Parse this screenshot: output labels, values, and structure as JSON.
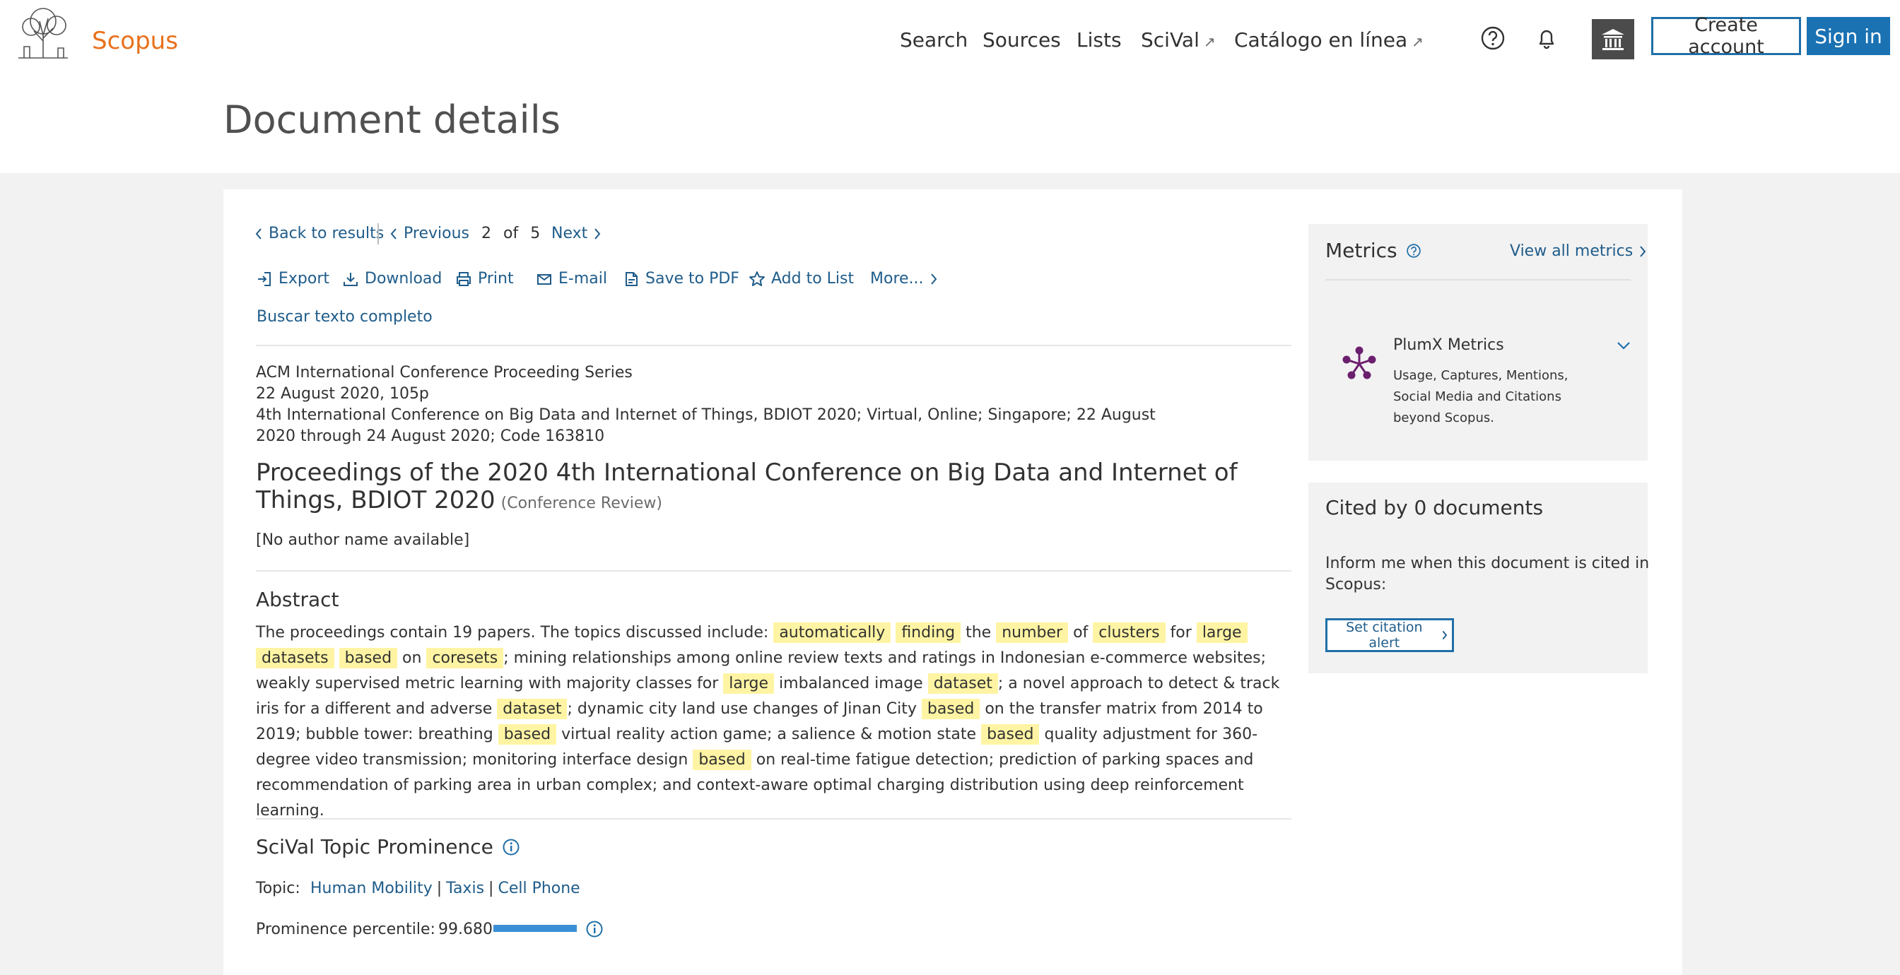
{
  "header": {
    "brand": "Scopus",
    "nav": [
      {
        "label": "Search"
      },
      {
        "label": "Sources"
      },
      {
        "label": "Lists"
      },
      {
        "label": "SciVal",
        "ext": "↗"
      },
      {
        "label": "Catálogo en línea",
        "ext": "↗"
      }
    ],
    "create_account": "Create account",
    "sign_in": "Sign in"
  },
  "page_title": "Document details",
  "navigation": {
    "back": "Back to results",
    "previous": "Previous",
    "position": "2",
    "of_label": "of",
    "total": "5",
    "next": "Next"
  },
  "actions": {
    "export": "Export",
    "download": "Download",
    "print": "Print",
    "email": "E-mail",
    "save_pdf": "Save to PDF",
    "add_list": "Add to List",
    "more": "More...",
    "full_text": "Buscar texto completo"
  },
  "document": {
    "source_lines": [
      "ACM International Conference Proceeding Series",
      "22 August 2020, 105p",
      "4th International Conference on Big Data and Internet of Things, BDIOT 2020; Virtual, Online; Singapore; 22 August",
      "2020 through 24 August 2020; Code 163810"
    ],
    "title": "Proceedings of the 2020 4th International Conference on Big Data and Internet of Things, BDIOT 2020",
    "doc_type": "(Conference Review)",
    "authors": "[No author name available]"
  },
  "abstract": {
    "heading": "Abstract",
    "segments": [
      {
        "t": "The proceedings contain 19 papers. The topics discussed include: "
      },
      {
        "t": "automatically",
        "h": true
      },
      {
        "t": " "
      },
      {
        "t": "finding",
        "h": true
      },
      {
        "t": " the "
      },
      {
        "t": "number",
        "h": true
      },
      {
        "t": " of "
      },
      {
        "t": "clusters",
        "h": true
      },
      {
        "t": " for "
      },
      {
        "t": "large",
        "h": true
      },
      {
        "t": " "
      },
      {
        "t": "datasets",
        "h": true
      },
      {
        "t": " "
      },
      {
        "t": "based",
        "h": true
      },
      {
        "t": " on "
      },
      {
        "t": "coresets",
        "h": true
      },
      {
        "t": "; mining relationships among online review texts and ratings in Indonesian e-commerce websites; weakly supervised metric learning with majority classes for "
      },
      {
        "t": "large",
        "h": true
      },
      {
        "t": " imbalanced image "
      },
      {
        "t": "dataset",
        "h": true
      },
      {
        "t": "; a novel approach to detect & track iris for a different and adverse "
      },
      {
        "t": "dataset",
        "h": true
      },
      {
        "t": "; dynamic city land use changes of Jinan City "
      },
      {
        "t": "based",
        "h": true
      },
      {
        "t": " on the transfer matrix from 2014 to 2019; bubble tower: breathing "
      },
      {
        "t": "based",
        "h": true
      },
      {
        "t": " virtual reality action game; a salience & motion state "
      },
      {
        "t": "based",
        "h": true
      },
      {
        "t": " quality adjustment for 360-degree video transmission; monitoring interface design "
      },
      {
        "t": "based",
        "h": true
      },
      {
        "t": " on real-time fatigue detection; prediction of parking spaces and recommendation of parking area in urban complex; and context-aware optimal charging distribution using deep reinforcement learning."
      }
    ]
  },
  "scival": {
    "heading": "SciVal Topic Prominence",
    "topic_label": "Topic:",
    "topics": [
      "Human Mobility",
      "Taxis",
      "Cell Phone"
    ],
    "separator": "|",
    "percentile_label": "Prominence percentile:",
    "percentile": "99.680",
    "percentile_fraction": 0.9968
  },
  "metrics": {
    "heading": "Metrics",
    "view_all": "View all metrics",
    "plumx_title": "PlumX Metrics",
    "plumx_desc": [
      "Usage, Captures, Mentions,",
      "Social Media and Citations",
      "beyond Scopus."
    ]
  },
  "cited": {
    "heading": "Cited by 0 documents",
    "desc": [
      "Inform me when this document is cited in",
      "Scopus:"
    ],
    "button": "Set citation alert"
  },
  "colors": {
    "link": "#1f5c8a",
    "brand_orange": "#e9711c",
    "highlight": "#fff4a3",
    "primary_button": "#1a72b3",
    "plumx": "#6b1f6e",
    "bar": "#3a8fd6"
  }
}
